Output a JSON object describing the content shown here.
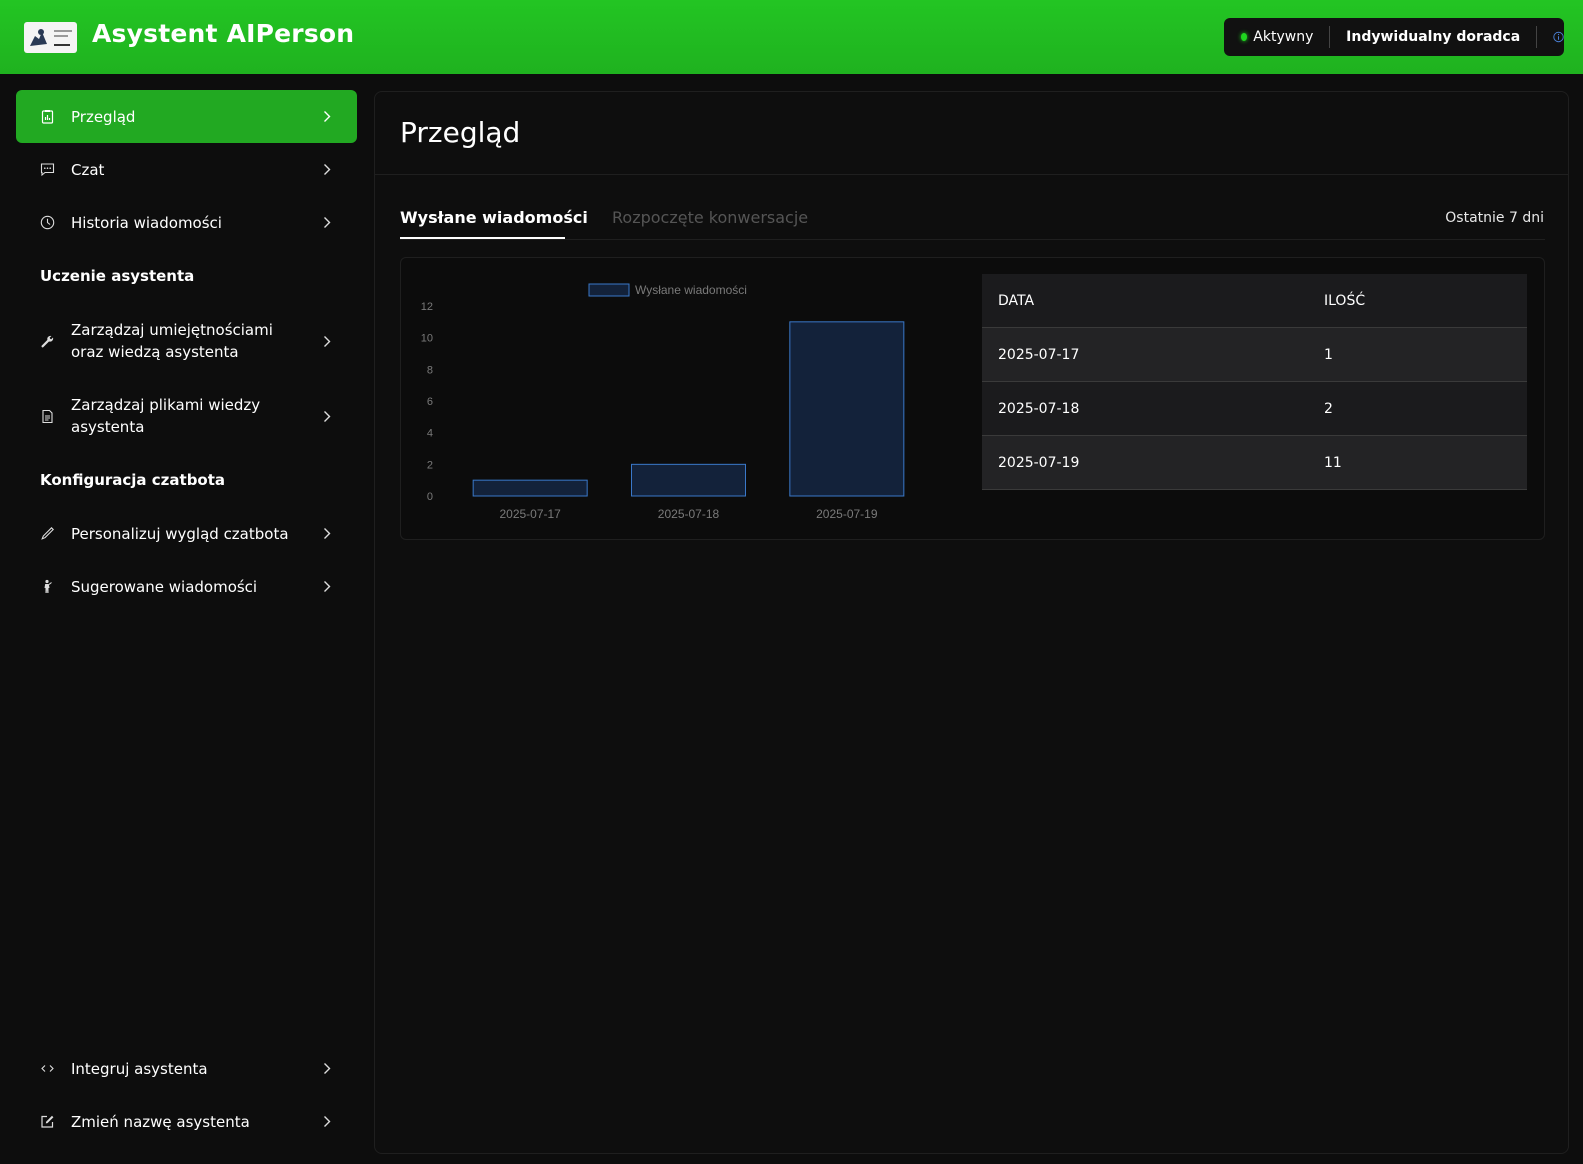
{
  "header": {
    "app_title": "Asystent AIPerson",
    "status_label": "Aktywny",
    "advisor_label": "Indywidualny doradca"
  },
  "sidebar": {
    "items": [
      {
        "label": "Przegląd",
        "icon": "clipboard-chart-icon",
        "active": true
      },
      {
        "label": "Czat",
        "icon": "chat-icon"
      },
      {
        "label": "Historia wiadomości",
        "icon": "clock-icon"
      }
    ],
    "section_training": "Uczenie asystenta",
    "training_items": [
      {
        "label": "Zarządzaj umiejętnościami oraz wiedzą asystenta",
        "icon": "wrench-icon"
      },
      {
        "label": "Zarządzaj plikami wiedzy asystenta",
        "icon": "document-icon"
      }
    ],
    "section_config": "Konfiguracja czatbota",
    "config_items": [
      {
        "label": "Personalizuj wygląd czatbota",
        "icon": "pen-icon"
      },
      {
        "label": "Sugerowane wiadomości",
        "icon": "person-icon"
      }
    ],
    "bottom_items": [
      {
        "label": "Integruj asystenta",
        "icon": "code-icon"
      },
      {
        "label": "Zmień nazwę asystenta",
        "icon": "edit-icon"
      }
    ]
  },
  "main": {
    "title": "Przegląd",
    "tabs": [
      {
        "label": "Wysłane wiadomości",
        "active": true
      },
      {
        "label": "Rozpoczęte konwersacje",
        "active": false
      }
    ],
    "range_label": "Ostatnie 7 dni",
    "table": {
      "headers": [
        "DATA",
        "ILOŚĆ"
      ],
      "rows": [
        [
          "2025-07-17",
          "1"
        ],
        [
          "2025-07-18",
          "2"
        ],
        [
          "2025-07-19",
          "11"
        ]
      ]
    }
  },
  "chart_data": {
    "type": "bar",
    "categories": [
      "2025-07-17",
      "2025-07-18",
      "2025-07-19"
    ],
    "series": [
      {
        "name": "Wysłane wiadomości",
        "values": [
          1,
          2,
          11
        ]
      }
    ],
    "y_ticks": [
      0,
      2,
      4,
      6,
      8,
      10,
      12
    ],
    "ylim": [
      0,
      12
    ],
    "legend": "top",
    "grid": false,
    "colors": {
      "bar_fill": "#13223a",
      "bar_stroke": "#3a78c9"
    }
  },
  "colors": {
    "accent_green": "#22a922",
    "header_green": "#23c523",
    "background": "#0d0d0d"
  }
}
